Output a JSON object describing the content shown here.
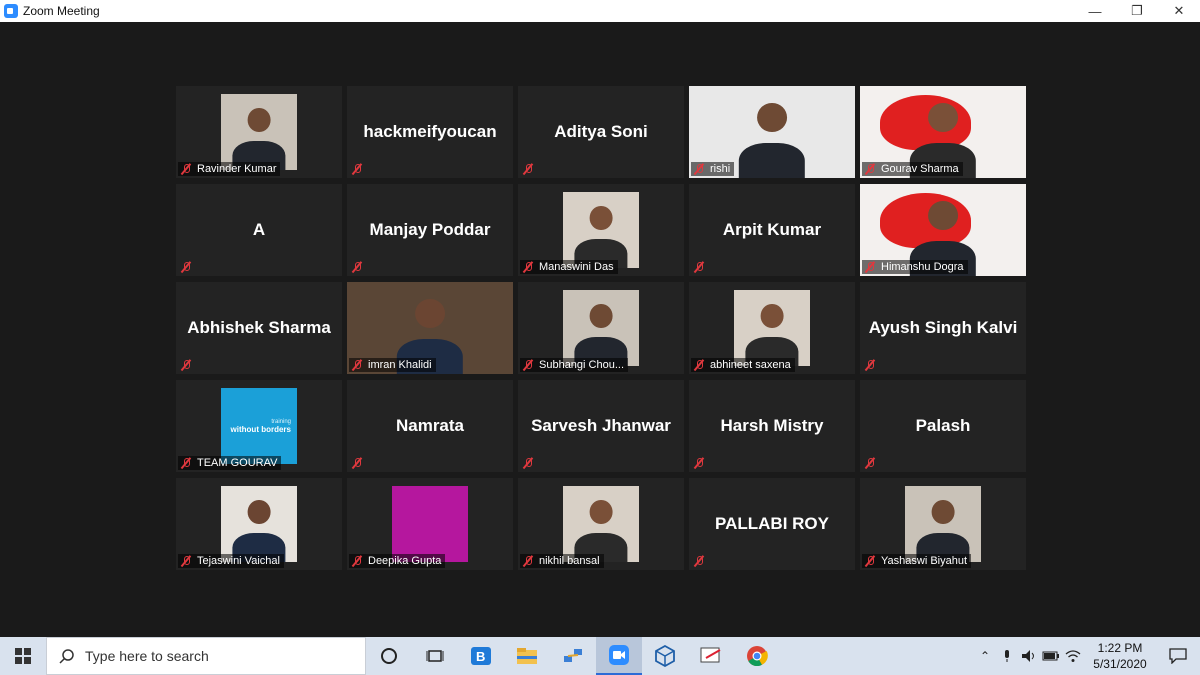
{
  "window": {
    "title": "Zoom Meeting"
  },
  "participants": [
    {
      "name": "Ravinder Kumar",
      "display": "photo",
      "big": ""
    },
    {
      "name": "",
      "display": "text",
      "big": "hackmeifyoucan"
    },
    {
      "name": "",
      "display": "text",
      "big": "Aditya Soni"
    },
    {
      "name": "rishi",
      "display": "video",
      "big": ""
    },
    {
      "name": "Gourav Sharma",
      "display": "video",
      "big": ""
    },
    {
      "name": "",
      "display": "text",
      "big": "A"
    },
    {
      "name": "",
      "display": "text",
      "big": "Manjay Poddar"
    },
    {
      "name": "Manaswini Das",
      "display": "photo",
      "big": ""
    },
    {
      "name": "",
      "display": "text",
      "big": "Arpit Kumar"
    },
    {
      "name": "Himanshu Dogra",
      "display": "video",
      "big": ""
    },
    {
      "name": "",
      "display": "text",
      "big": "Abhishek Sharma"
    },
    {
      "name": "imran Khalidi",
      "display": "video",
      "big": "",
      "active": true
    },
    {
      "name": "Subhangi Chou...",
      "display": "photo",
      "big": ""
    },
    {
      "name": "abhineet saxena",
      "display": "photo",
      "big": ""
    },
    {
      "name": "",
      "display": "text",
      "big": "Ayush Singh Kalvi"
    },
    {
      "name": "TEAM GOURAV",
      "display": "logo",
      "big": "",
      "logo_text": "without borders",
      "logo_small": "training"
    },
    {
      "name": "",
      "display": "text",
      "big": "Namrata"
    },
    {
      "name": "",
      "display": "text",
      "big": "Sarvesh Jhanwar"
    },
    {
      "name": "",
      "display": "text",
      "big": "Harsh Mistry"
    },
    {
      "name": "",
      "display": "text",
      "big": "Palash"
    },
    {
      "name": "Tejaswini Vaichal",
      "display": "photo",
      "big": ""
    },
    {
      "name": "Deepika Gupta",
      "display": "solid",
      "big": ""
    },
    {
      "name": "nikhil bansal",
      "display": "photo",
      "big": ""
    },
    {
      "name": "",
      "display": "text",
      "big": "PALLABI ROY"
    },
    {
      "name": "Yashaswi Biyahut",
      "display": "photo",
      "big": ""
    }
  ],
  "taskbar": {
    "search_placeholder": "Type here to search",
    "time": "1:22 PM",
    "date": "5/31/2020"
  },
  "colors": {
    "accent": "#c9e36a",
    "mute": "#e0383e",
    "zoom_blue": "#2d8cff",
    "logo_blue": "#1ba0d8",
    "magenta": "#b5179e"
  }
}
